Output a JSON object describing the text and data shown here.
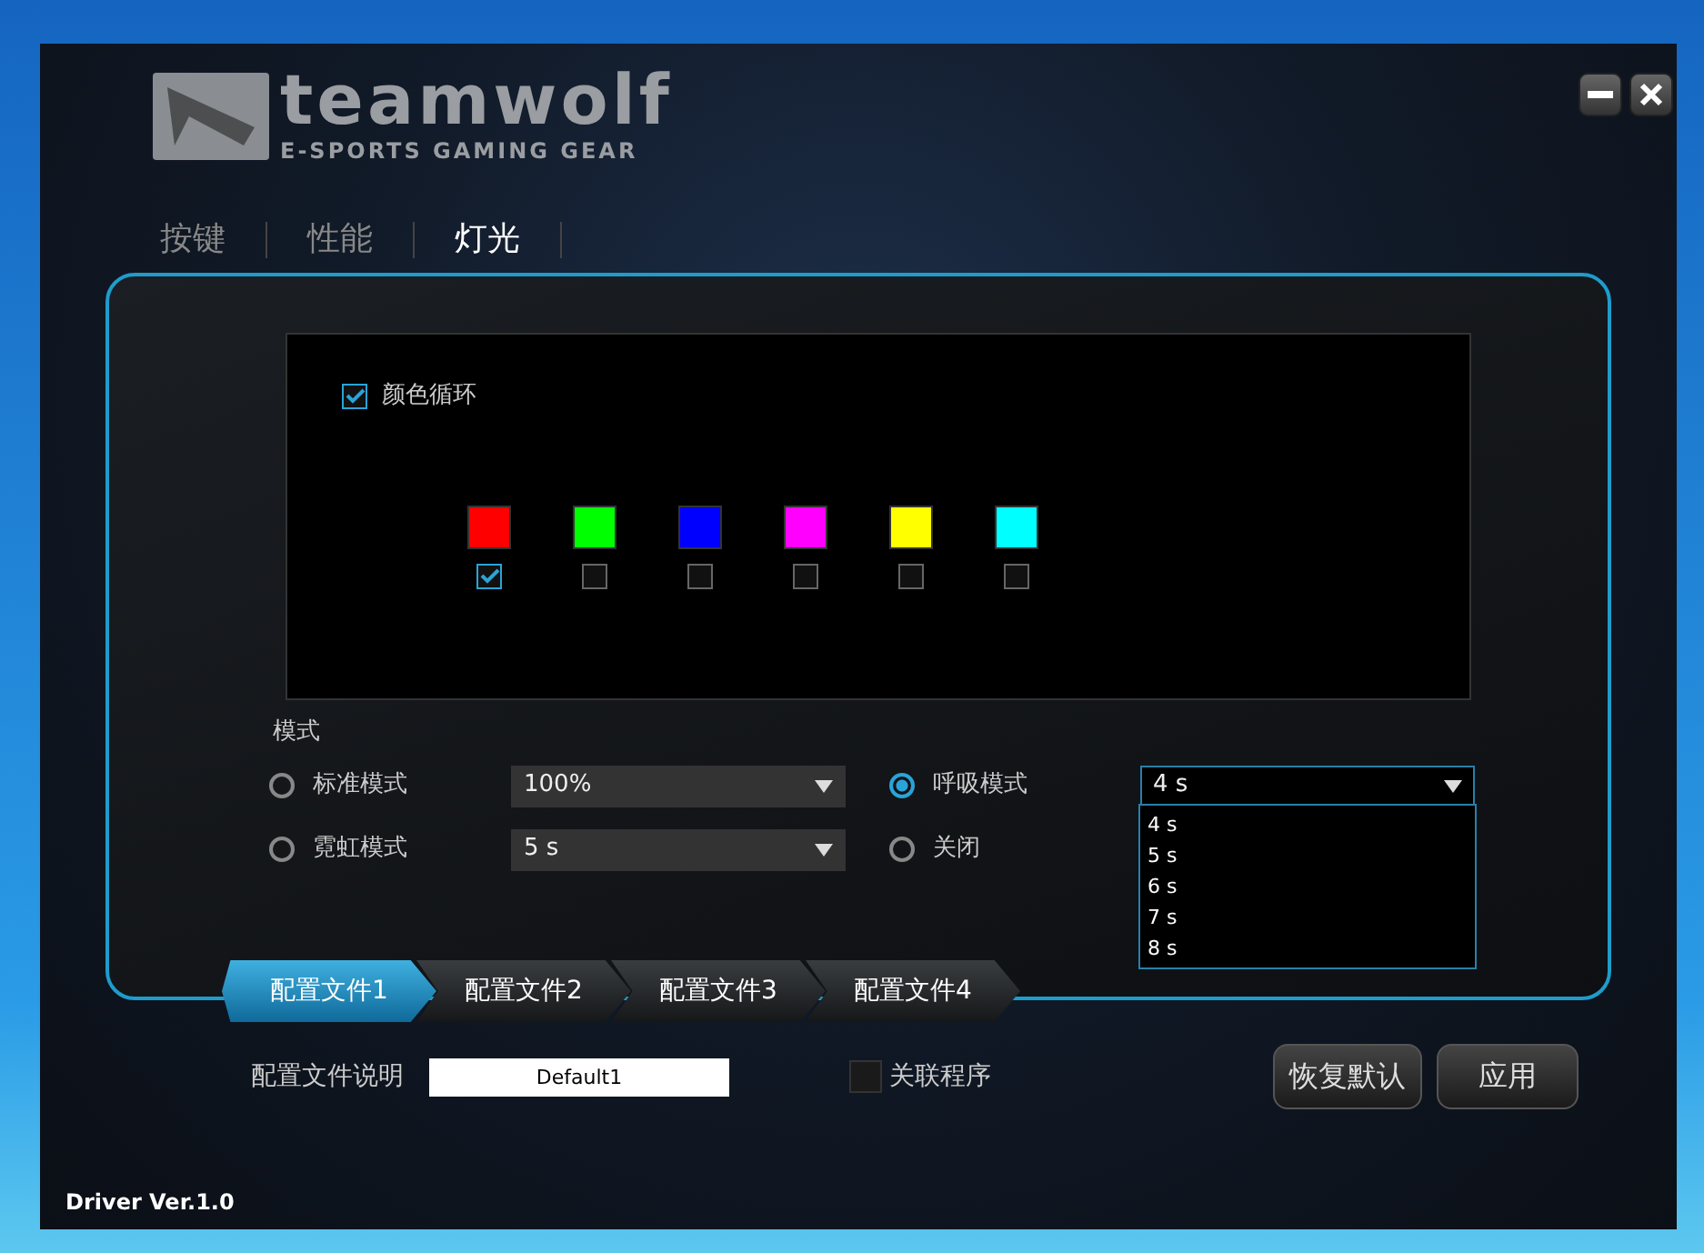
{
  "window": {
    "logo": {
      "wordmark": "teamwolf",
      "tagline": "E-SPORTS GAMING GEAR"
    }
  },
  "tabs": [
    {
      "label": "按键",
      "selected": false
    },
    {
      "label": "性能",
      "selected": false
    },
    {
      "label": "灯光",
      "selected": true
    }
  ],
  "lighting": {
    "color_cycle": {
      "label": "颜色循环",
      "checked": true
    },
    "colors": [
      {
        "color": "#ff0000",
        "checked": true
      },
      {
        "color": "#00ff00",
        "checked": false
      },
      {
        "color": "#0000ff",
        "checked": false
      },
      {
        "color": "#ff00ff",
        "checked": false
      },
      {
        "color": "#ffff00",
        "checked": false
      },
      {
        "color": "#00ffff",
        "checked": false
      }
    ]
  },
  "mode": {
    "label": "模式",
    "options": [
      {
        "label": "标准模式",
        "selected": false,
        "dropdown": {
          "value": "100%"
        }
      },
      {
        "label": "霓虹模式",
        "selected": false,
        "dropdown": {
          "value": "5 s"
        }
      },
      {
        "label": "呼吸模式",
        "selected": true,
        "dropdown": {
          "value": "4 s",
          "expanded": true,
          "list": [
            "4 s",
            "5 s",
            "6 s",
            "7 s",
            "8 s"
          ]
        }
      },
      {
        "label": "关闭",
        "selected": false
      }
    ]
  },
  "profiles": [
    {
      "label": "配置文件1",
      "selected": true
    },
    {
      "label": "配置文件2",
      "selected": false
    },
    {
      "label": "配置文件3",
      "selected": false
    },
    {
      "label": "配置文件4",
      "selected": false
    }
  ],
  "profile_description": {
    "label": "配置文件说明",
    "value": "Default1"
  },
  "link_program": {
    "label": "关联程序",
    "checked": false
  },
  "buttons": [
    "恢复默认",
    "应用"
  ],
  "version": "Driver Ver.1.0"
}
